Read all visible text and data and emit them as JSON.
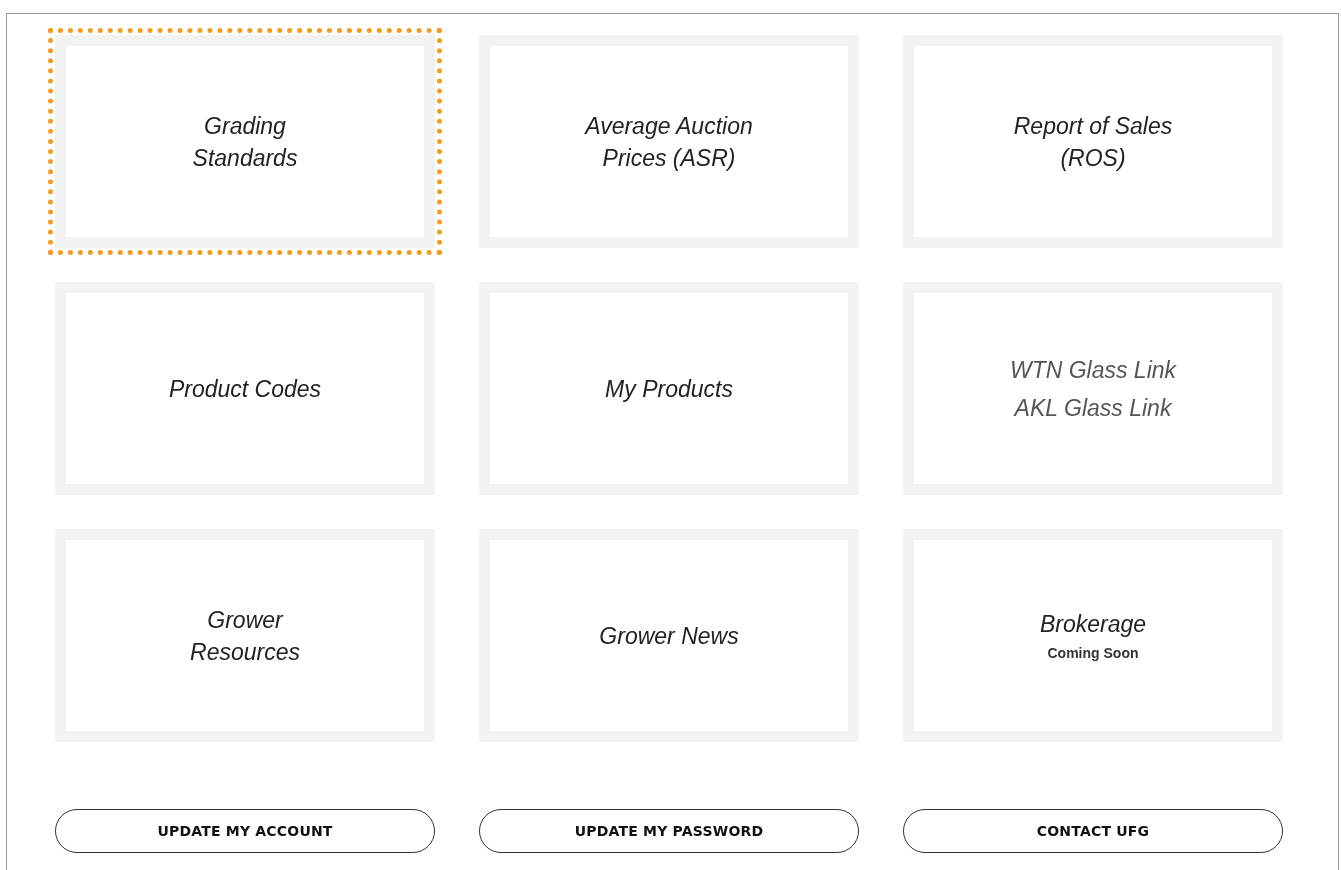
{
  "tiles": [
    {
      "lines": [
        {
          "text": "Grading",
          "kind": "title"
        },
        {
          "text": "Standards",
          "kind": "title"
        }
      ],
      "focused": true
    },
    {
      "lines": [
        {
          "text": "Average Auction",
          "kind": "title"
        },
        {
          "text": "Prices (ASR)",
          "kind": "title"
        }
      ],
      "focused": false
    },
    {
      "lines": [
        {
          "text": "Report of Sales",
          "kind": "title"
        },
        {
          "text": "(ROS)",
          "kind": "title"
        }
      ],
      "focused": false
    },
    {
      "lines": [
        {
          "text": "Product Codes",
          "kind": "title"
        }
      ],
      "focused": false
    },
    {
      "lines": [
        {
          "text": "My Products",
          "kind": "title"
        }
      ],
      "focused": false
    },
    {
      "lines": [
        {
          "text": "WTN Glass Link",
          "kind": "link"
        },
        {
          "text": "AKL Glass Link",
          "kind": "link"
        }
      ],
      "focused": false
    },
    {
      "lines": [
        {
          "text": "Grower",
          "kind": "title"
        },
        {
          "text": "Resources",
          "kind": "title"
        }
      ],
      "focused": false
    },
    {
      "lines": [
        {
          "text": "Grower News",
          "kind": "title"
        }
      ],
      "focused": false
    },
    {
      "lines": [
        {
          "text": "Brokerage",
          "kind": "title"
        },
        {
          "text": "Coming Soon",
          "kind": "note"
        }
      ],
      "focused": false
    }
  ],
  "buttons": [
    "UPDATE MY ACCOUNT",
    "UPDATE MY PASSWORD",
    "CONTACT UFG"
  ]
}
